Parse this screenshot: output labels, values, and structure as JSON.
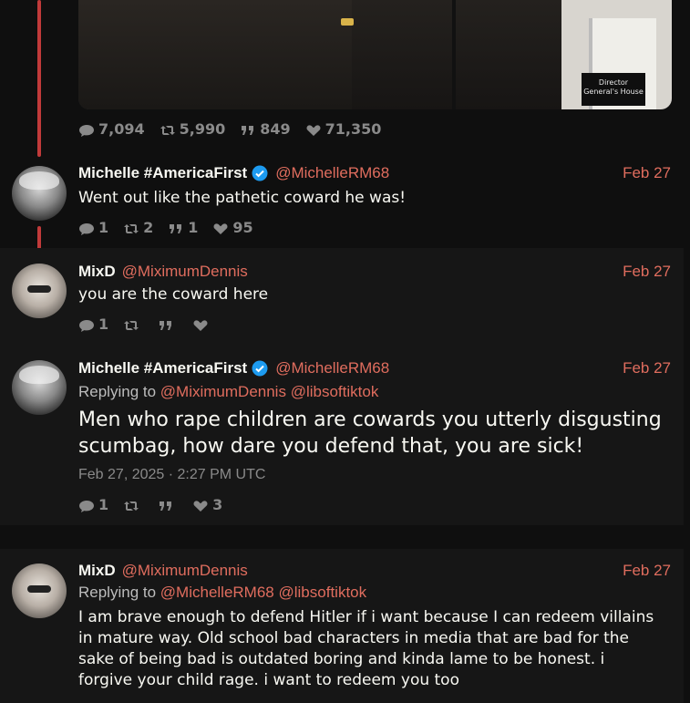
{
  "main_tweet": {
    "media_sign": "Director\nGeneral's House",
    "stats": {
      "replies": "7,094",
      "retweets": "5,990",
      "quotes": "849",
      "likes": "71,350"
    }
  },
  "replies": [
    {
      "name": "Michelle #AmericaFirst",
      "verified": true,
      "handle": "@MichelleRM68",
      "date": "Feb 27",
      "text": "Went out like the pathetic coward he was!",
      "stats": {
        "replies": "1",
        "retweets": "2",
        "quotes": "1",
        "likes": "95"
      }
    },
    {
      "name": "MixD",
      "handle": "@MiximumDennis",
      "date": "Feb 27",
      "text": "you are the coward here",
      "stats": {
        "replies": "1",
        "retweets": "",
        "quotes": "",
        "likes": ""
      }
    },
    {
      "name": "Michelle #AmericaFirst",
      "verified": true,
      "handle": "@MichelleRM68",
      "date": "Feb 27",
      "replying_label": "Replying to",
      "replying_to": [
        "@MiximumDennis",
        "@libsoftiktok"
      ],
      "text": "Men who rape children are cowards you utterly disgusting scumbag, how dare you defend that, you are sick!",
      "timestamp": "Feb 27, 2025 · 2:27 PM UTC",
      "stats": {
        "replies": "1",
        "retweets": "",
        "quotes": "",
        "likes": "3"
      }
    },
    {
      "name": "MixD",
      "handle": "@MiximumDennis",
      "date": "Feb 27",
      "replying_label": "Replying to",
      "replying_to": [
        "@MichelleRM68",
        "@libsoftiktok"
      ],
      "text": "I am brave enough to defend Hitler if i want because I can redeem villains in mature way. Old school bad characters in media that are bad for the sake of being bad is outdated boring and kinda lame to be honest. i forgive your child rage. i want to redeem you too"
    }
  ],
  "colors": {
    "accent": "#e06d5e",
    "thread_line": "#c13a3a",
    "muted": "#8a8a8a",
    "verified": "#1d9bf0"
  }
}
